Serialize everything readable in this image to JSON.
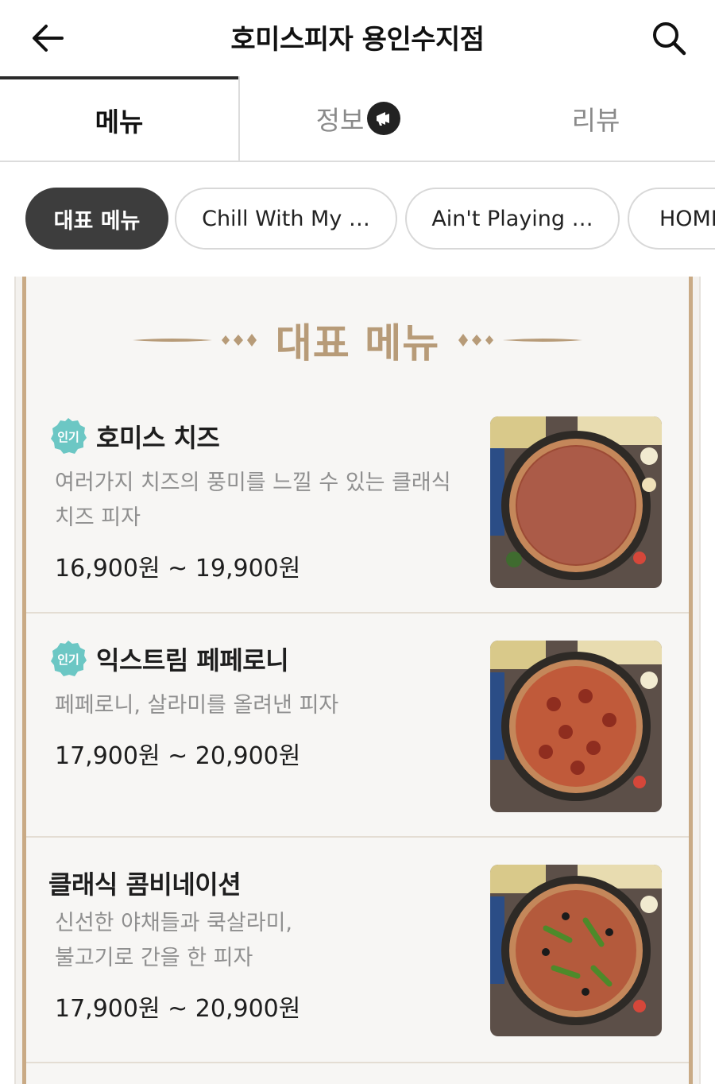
{
  "header": {
    "title": "호미스피자 용인수지점",
    "back_icon": "arrow-left-icon",
    "search_icon": "search-icon"
  },
  "tabs": [
    {
      "label": "메뉴",
      "active": true
    },
    {
      "label": "정보",
      "active": false,
      "badge_icon": "megaphone-icon"
    },
    {
      "label": "리뷰",
      "active": false
    }
  ],
  "categories": [
    {
      "label": "대표 메뉴",
      "active": true
    },
    {
      "label": "Chill With My …",
      "active": false
    },
    {
      "label": "Ain't Playing …",
      "active": false
    },
    {
      "label": "HOMI",
      "active": false
    }
  ],
  "menu_section": {
    "title": "대표 메뉴",
    "items": [
      {
        "badge": "인기",
        "name": "호미스 치즈",
        "desc_lines": [
          "여러가지 치즈의 풍미를 느낄 수 있는 클래식",
          "치즈 피자"
        ],
        "price": "16,900원 ~ 19,900원"
      },
      {
        "badge": "인기",
        "name": "익스트림 페페로니",
        "desc_lines": [
          "페페로니, 살라미를 올려낸 피자"
        ],
        "price": "17,900원 ~ 20,900원"
      },
      {
        "badge": "",
        "name": "클래식 콤비네이션",
        "desc_lines": [
          "신선한 야채들과 쿡살라미,",
          "불고기로 간을 한 피자"
        ],
        "price": "17,900원 ~ 20,900원"
      }
    ]
  },
  "colors": {
    "accent_gold": "#b79b78",
    "frame_gold": "#c9aa85",
    "popular_badge": "#6cc7c4",
    "active_chip": "#3d3d3d"
  }
}
